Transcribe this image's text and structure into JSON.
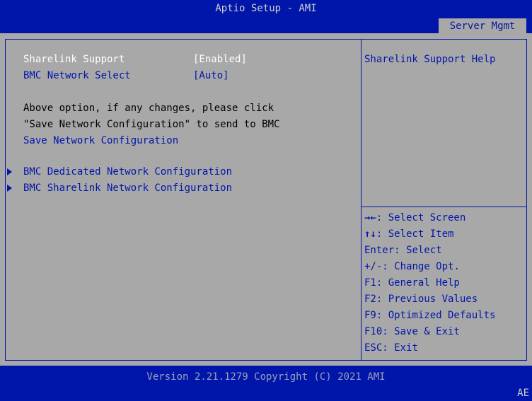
{
  "header": {
    "title": "Aptio Setup - AMI",
    "active_tab": "Server Mgmt"
  },
  "main": {
    "settings": [
      {
        "label": "Sharelink Support",
        "value": "[Enabled]"
      },
      {
        "label": "BMC Network Select",
        "value": "[Auto]"
      }
    ],
    "note_lines": [
      "Above option, if any changes, please click",
      "\"Save Network Configuration\" to send to BMC"
    ],
    "save_action": "Save Network Configuration",
    "submenus": [
      "BMC Dedicated Network Configuration",
      "BMC Sharelink Network Configuration"
    ]
  },
  "help": {
    "text": "Sharelink Support Help"
  },
  "keys": [
    {
      "key": "→←",
      "desc": ": Select Screen"
    },
    {
      "key": "↑↓",
      "desc": ": Select Item"
    },
    {
      "key": "Enter",
      "desc": ": Select"
    },
    {
      "key": "+/-",
      "desc": ": Change Opt."
    },
    {
      "key": "F1",
      "desc": ": General Help"
    },
    {
      "key": "F2",
      "desc": ": Previous Values"
    },
    {
      "key": "F9",
      "desc": ": Optimized Defaults"
    },
    {
      "key": "F10",
      "desc": ": Save & Exit"
    },
    {
      "key": "ESC",
      "desc": ": Exit"
    }
  ],
  "footer": {
    "version": "Version 2.21.1279 Copyright (C) 2021 AMI",
    "corner": "AE"
  },
  "colors": {
    "background": "#a8a8a8",
    "bar": "#0016aa",
    "highlight": "#ffffff"
  }
}
